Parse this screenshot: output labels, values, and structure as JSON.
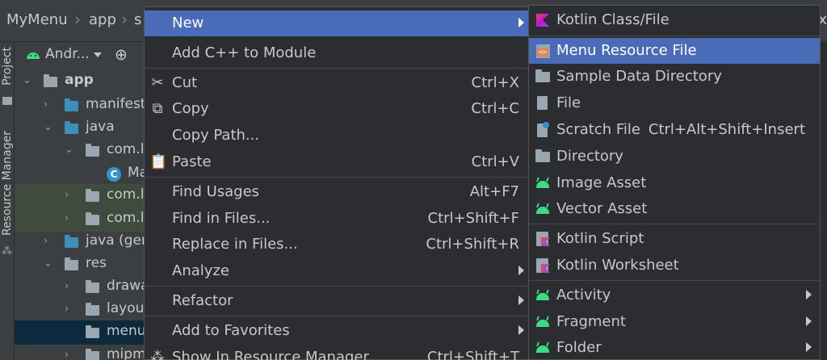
{
  "breadcrumb": {
    "items": [
      "MyMenu",
      "app",
      "s"
    ],
    "tail": "ix"
  },
  "toolstrip": {
    "project_tab": "Project",
    "resource_manager_tab": "Resource Manager"
  },
  "panel": {
    "dropdown_label": "Andr...",
    "tree": [
      {
        "label": "app",
        "kind": "module"
      },
      {
        "label": "manifest",
        "kind": "folder"
      },
      {
        "label": "java",
        "kind": "folder"
      },
      {
        "label": "com.l",
        "kind": "package"
      },
      {
        "label": "Ma",
        "kind": "class"
      },
      {
        "label": "com.l",
        "kind": "package"
      },
      {
        "label": "com.l",
        "kind": "package"
      },
      {
        "label": "java (ger",
        "kind": "folder"
      },
      {
        "label": "res",
        "kind": "folder"
      },
      {
        "label": "drawa",
        "kind": "folder"
      },
      {
        "label": "layou",
        "kind": "folder"
      },
      {
        "label": "menu",
        "kind": "folder"
      },
      {
        "label": "mipm",
        "kind": "folder"
      }
    ]
  },
  "menu": {
    "new": "New",
    "add_cpp": "Add C++ to Module",
    "cut": "Cut",
    "cut_key": "Ctrl+X",
    "copy": "Copy",
    "copy_key": "Ctrl+C",
    "copy_path": "Copy Path...",
    "paste": "Paste",
    "paste_key": "Ctrl+V",
    "find_usages": "Find Usages",
    "find_usages_key": "Alt+F7",
    "find_in_files": "Find in Files...",
    "find_in_files_key": "Ctrl+Shift+F",
    "replace_in_files": "Replace in Files...",
    "replace_in_files_key": "Ctrl+Shift+R",
    "analyze": "Analyze",
    "refactor": "Refactor",
    "add_favorites": "Add to Favorites",
    "show_resource_manager": "Show In Resource Manager",
    "show_resource_manager_key": "Ctrl+Shift+T"
  },
  "submenu": {
    "kotlin_class": "Kotlin Class/File",
    "menu_resource": "Menu Resource File",
    "sample_data": "Sample Data Directory",
    "file": "File",
    "scratch": "Scratch File",
    "scratch_key": "Ctrl+Alt+Shift+Insert",
    "directory": "Directory",
    "image_asset": "Image Asset",
    "vector_asset": "Vector Asset",
    "kotlin_script": "Kotlin Script",
    "kotlin_worksheet": "Kotlin Worksheet",
    "activity": "Activity",
    "fragment": "Fragment",
    "folder": "Folder"
  },
  "colors": {
    "highlight": "#4a6cb8",
    "background": "#2b2d30",
    "panel": "#3c3f41",
    "android_green": "#3ddc84"
  }
}
